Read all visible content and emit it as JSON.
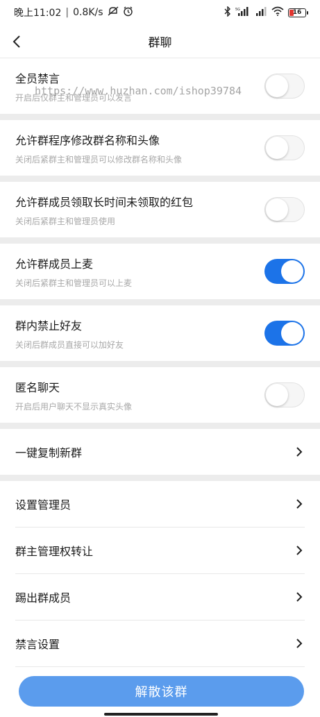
{
  "statusbar": {
    "time": "晚上11:02",
    "separator": "|",
    "speed": "0.8K/s",
    "battery": "16",
    "icons": [
      "no-notify-icon",
      "alarm-icon",
      "bluetooth-icon",
      "signal-icon",
      "signal-icon",
      "wifi-icon",
      "battery-icon"
    ]
  },
  "navbar": {
    "title": "群聊",
    "back_icon": "back-arrow-icon"
  },
  "watermark": "https://www.huzhan.com/ishop39784",
  "toggles": [
    {
      "label": "全员禁言",
      "desc": "开启后仅群主和管理员可以发言",
      "on": false
    },
    {
      "label": "允许群程序修改群名称和头像",
      "desc": "关闭后紧群主和管理员可以修改群名称和头像",
      "on": false
    },
    {
      "label": "允许群成员领取长时间未领取的红包",
      "desc": "关闭后紧群主和管理员使用",
      "on": false
    },
    {
      "label": "允许群成员上麦",
      "desc": "关闭后紧群主和管理员可以上麦",
      "on": true
    },
    {
      "label": "群内禁止好友",
      "desc": "关闭后群成员直接可以加好友",
      "on": true
    },
    {
      "label": "匿名聊天",
      "desc": "开启后用户聊天不显示真实头像",
      "on": false
    }
  ],
  "copy_group": {
    "label": "一键复制新群",
    "icon": "chevron-right-icon"
  },
  "nav_items": [
    {
      "label": "设置管理员",
      "icon": "chevron-right-icon"
    },
    {
      "label": "群主管理权转让",
      "icon": "chevron-right-icon"
    },
    {
      "label": "踢出群成员",
      "icon": "chevron-right-icon"
    },
    {
      "label": "禁言设置",
      "icon": "chevron-right-icon"
    }
  ],
  "dissolve_button": "解散该群",
  "colors": {
    "switch_on": "#1c73e8",
    "button": "#5b9ced",
    "separator": "#ececec",
    "desc_text": "#a8a8a8"
  }
}
